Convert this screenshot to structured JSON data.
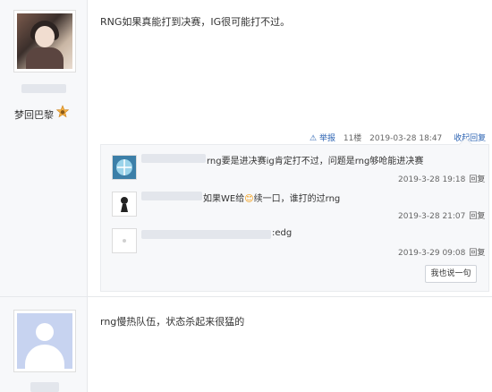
{
  "post1": {
    "username": "梦回巴黎",
    "text": "RNG如果真能打到决赛，IG很可能打不过。",
    "report_label": "举报",
    "floor": "11楼",
    "datetime": "2019-03-28 18:47",
    "collapse_reply_label": "收起回复",
    "replies": [
      {
        "text": "rng要是进决赛ig肯定打不过，问题是rng够呛能进决赛",
        "time": "2019-3-28 19:18",
        "reply_label": "回复"
      },
      {
        "text_before": "如果WE给",
        "text_after": "续一口，谁打的过rng",
        "time": "2019-3-28 21:07",
        "reply_label": "回复"
      },
      {
        "text": ":edg",
        "time": "2019-3-29 09:08",
        "reply_label": "回复"
      }
    ],
    "say_button": "我也说一句"
  },
  "post2": {
    "text": "rng慢热队伍，状态杀起来很猛的"
  },
  "colors": {
    "link": "#2d64b3",
    "accent": "#f5b041"
  }
}
